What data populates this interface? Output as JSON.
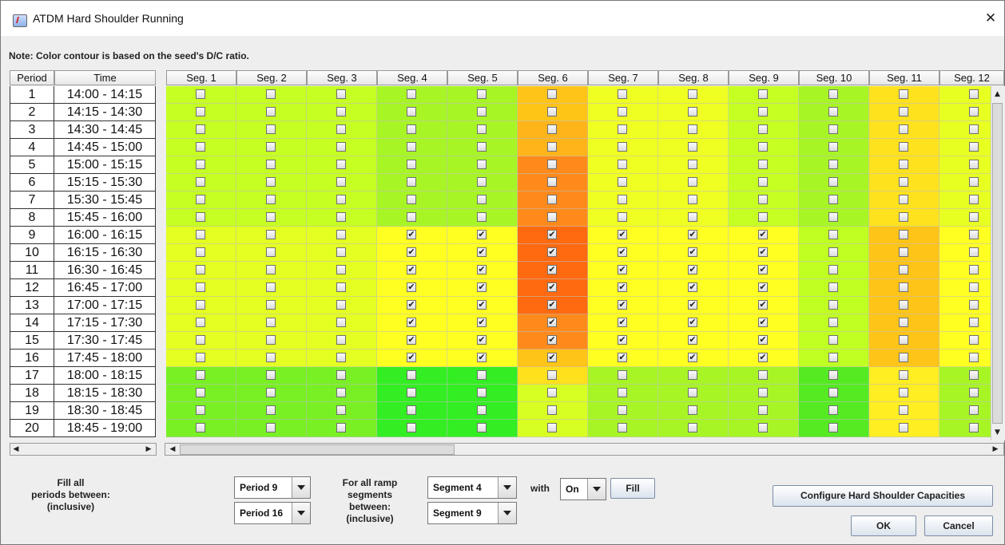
{
  "window": {
    "title": "ATDM Hard Shoulder Running",
    "close_glyph": "✕",
    "app_icon": "java-cup-icon"
  },
  "note": "Note: Color contour is based on the seed's D/C ratio.",
  "table": {
    "left_headers": [
      "Period",
      "Time"
    ],
    "periods": [
      {
        "period": "1",
        "time": "14:00 - 14:15"
      },
      {
        "period": "2",
        "time": "14:15 - 14:30"
      },
      {
        "period": "3",
        "time": "14:30 - 14:45"
      },
      {
        "period": "4",
        "time": "14:45 - 15:00"
      },
      {
        "period": "5",
        "time": "15:00 - 15:15"
      },
      {
        "period": "6",
        "time": "15:15 - 15:30"
      },
      {
        "period": "7",
        "time": "15:30 - 15:45"
      },
      {
        "period": "8",
        "time": "15:45 - 16:00"
      },
      {
        "period": "9",
        "time": "16:00 - 16:15"
      },
      {
        "period": "10",
        "time": "16:15 - 16:30"
      },
      {
        "period": "11",
        "time": "16:30 - 16:45"
      },
      {
        "period": "12",
        "time": "16:45 - 17:00"
      },
      {
        "period": "13",
        "time": "17:00 - 17:15"
      },
      {
        "period": "14",
        "time": "17:15 - 17:30"
      },
      {
        "period": "15",
        "time": "17:30 - 17:45"
      },
      {
        "period": "16",
        "time": "17:45 - 18:00"
      },
      {
        "period": "17",
        "time": "18:00 - 18:15"
      },
      {
        "period": "18",
        "time": "18:15 - 18:30"
      },
      {
        "period": "19",
        "time": "18:30 - 18:45"
      },
      {
        "period": "20",
        "time": "18:45 - 19:00"
      }
    ],
    "segments": [
      "Seg. 1",
      "Seg. 2",
      "Seg. 3",
      "Seg. 4",
      "Seg. 5",
      "Seg. 6",
      "Seg. 7",
      "Seg. 8",
      "Seg. 9",
      "Seg. 10",
      "Seg. 11",
      "Seg. 12"
    ],
    "checked": {
      "periods": [
        9,
        16
      ],
      "segments": [
        4,
        9
      ]
    },
    "checked_glyph": "✔",
    "contour_colors": {
      "green": "#33ee22",
      "yellowgreen": "#c6ff22",
      "yellow": "#ffff22",
      "amber": "#ffc418",
      "orange": "#ff8a1c",
      "deep_orange": "#ff6a10"
    }
  },
  "controls": {
    "fill_periods_label": "Fill all\nperiods between:\n(inclusive)",
    "period_from": "Period 9",
    "period_to": "Period 16",
    "ramp_label": "For all ramp\nsegments\nbetween:\n(inclusive)",
    "segment_from": "Segment 4",
    "segment_to": "Segment 9",
    "with_label": "with",
    "with_value": "On",
    "fill_button": "Fill",
    "configure_button": "Configure Hard Shoulder Capacities",
    "ok_button": "OK",
    "cancel_button": "Cancel"
  }
}
